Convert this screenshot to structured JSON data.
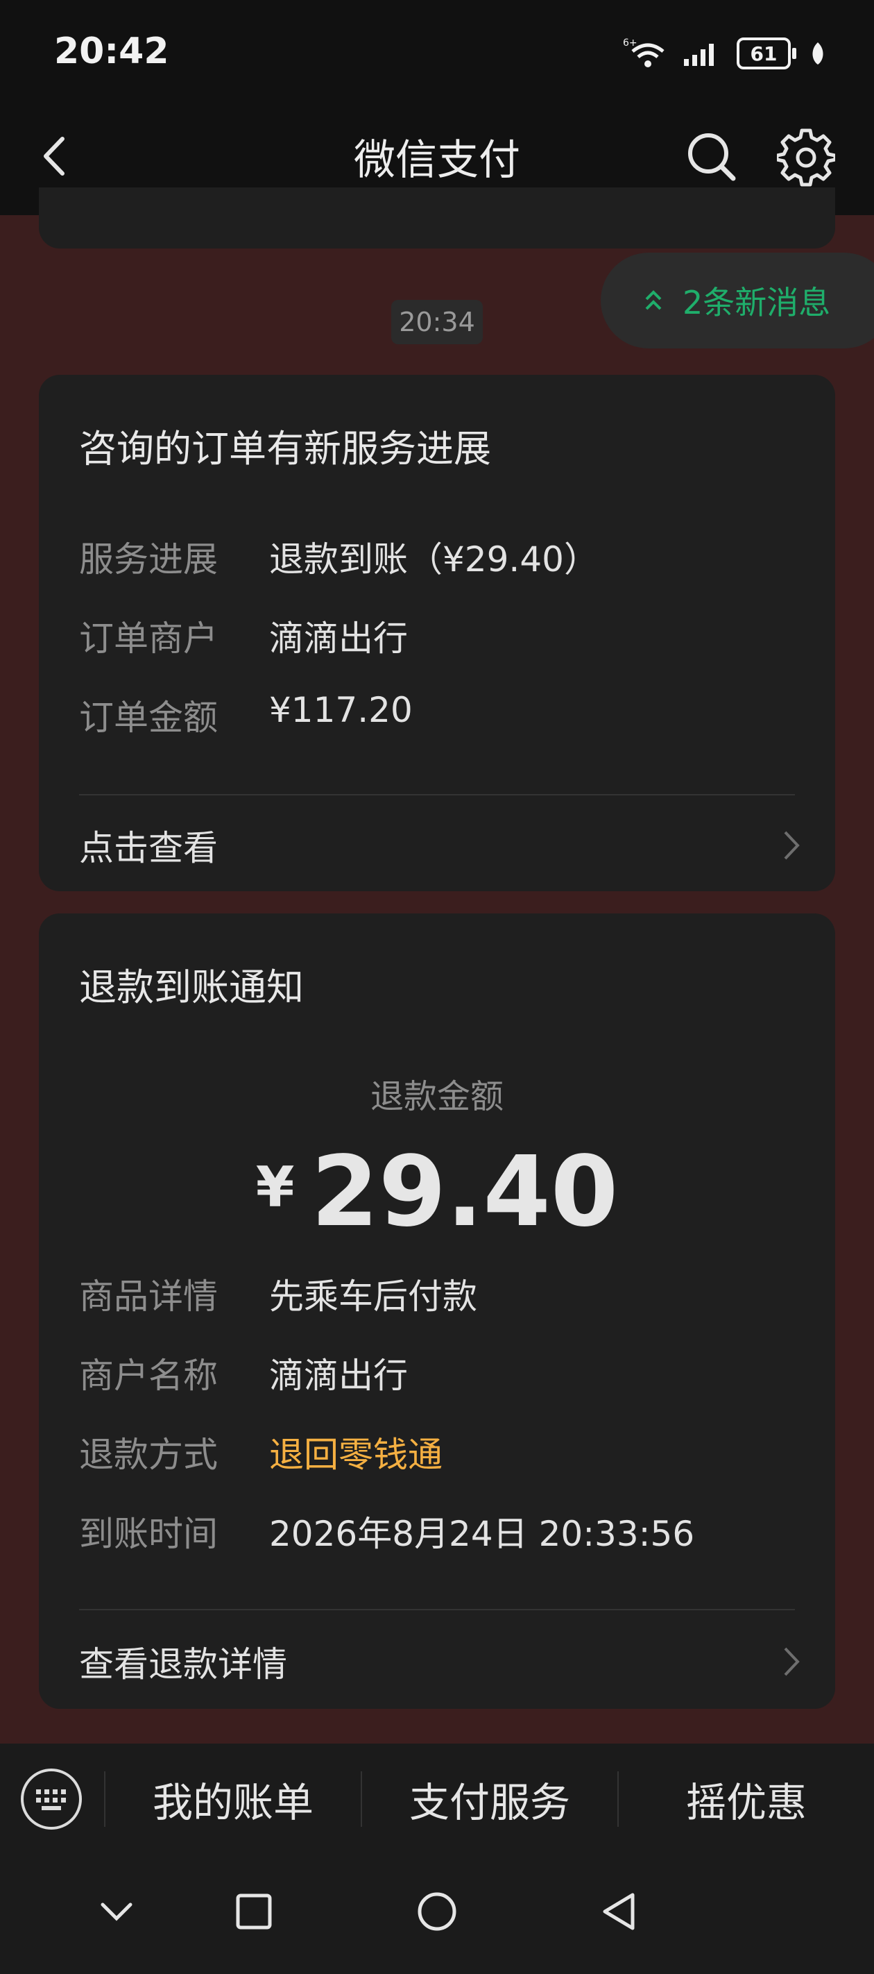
{
  "status_bar": {
    "time": "20:42",
    "battery": "61",
    "network": "6+"
  },
  "nav": {
    "title": "微信支付"
  },
  "new_messages": {
    "label": "2条新消息"
  },
  "timestamp": "20:34",
  "service_card": {
    "title": "咨询的订单有新服务进展",
    "rows": [
      {
        "label": "服务进展",
        "value": "退款到账（¥29.40）"
      },
      {
        "label": "订单商户",
        "value": "滴滴出行"
      },
      {
        "label": "订单金额",
        "value": "¥117.20"
      }
    ],
    "link": "点击查看"
  },
  "refund_card": {
    "title": "退款到账通知",
    "amount_label": "退款金额",
    "amount_symbol": "¥",
    "amount": "29.40",
    "rows": [
      {
        "label": "商品详情",
        "value": "先乘车后付款"
      },
      {
        "label": "商户名称",
        "value": "滴滴出行"
      },
      {
        "label": "退款方式",
        "value": "退回零钱通"
      },
      {
        "label": "到账时间",
        "value": "2026年8月24日 20:33:56"
      }
    ],
    "link": "查看退款详情",
    "highlight_color": "#f5b042"
  },
  "bottom_menu": [
    "我的账单",
    "支付服务",
    "摇优惠"
  ],
  "icons": [
    "back-icon",
    "search-icon",
    "gear-icon",
    "chevron-up-icon",
    "chevron-right-icon",
    "keyboard-icon",
    "chevron-down-icon",
    "square-icon",
    "circle-icon",
    "triangle-back-icon"
  ]
}
